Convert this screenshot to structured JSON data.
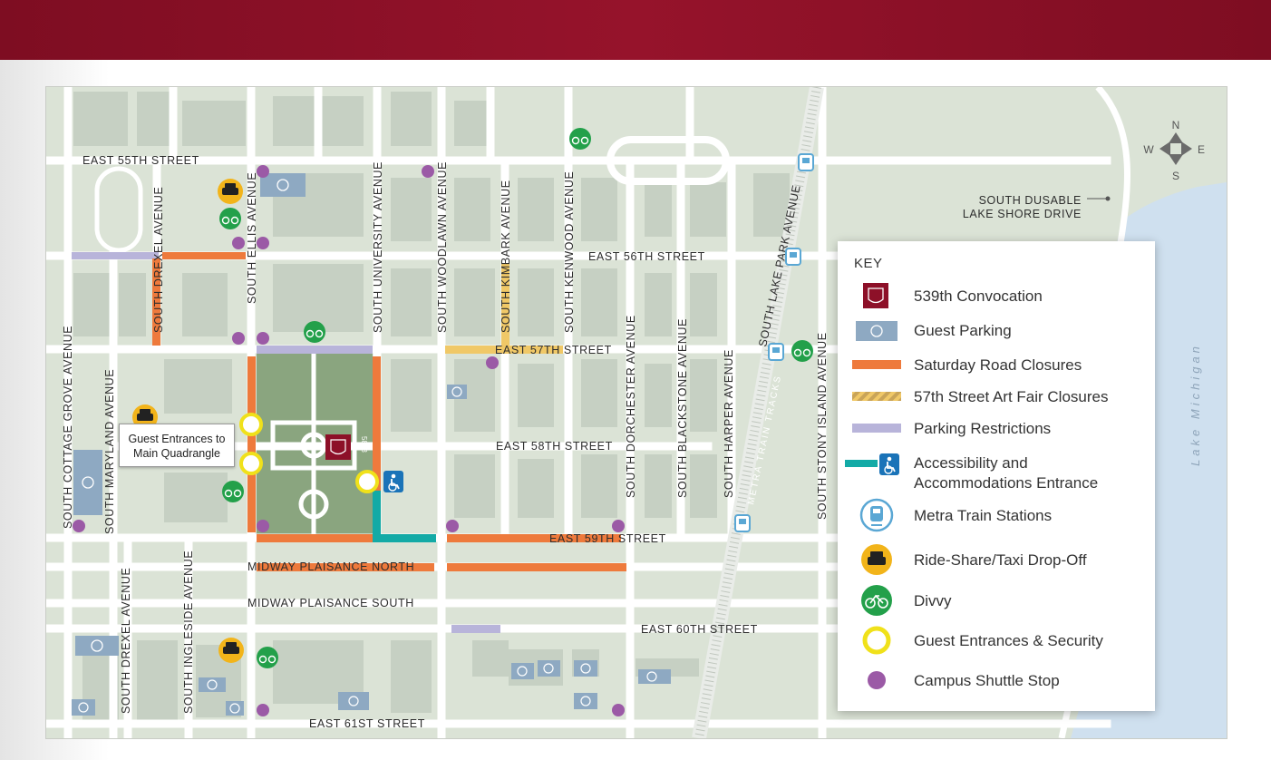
{
  "colors": {
    "header": "#8d1028",
    "road_closure": "#ee7a3c",
    "art_fair": "#f0c867",
    "parking_restriction": "#b8b4da",
    "accessibility": "#13aaa6",
    "shuttle": "#9b5aa6",
    "divvy": "#23a04a",
    "taxi": "#f2b41a",
    "parking": "#8ea9c2",
    "metra": "#5aa7d4",
    "convocation": "#8d1028"
  },
  "streets": {
    "e55": "EAST 55TH STREET",
    "e56": "EAST 56TH STREET",
    "e57": "EAST 57TH STREET",
    "e58": "EAST 58TH STREET",
    "e59": "EAST 59TH STREET",
    "e60": "EAST 60TH STREET",
    "e61": "EAST 61ST STREET",
    "mid_n": "MIDWAY PLAISANCE NORTH",
    "mid_s": "MIDWAY PLAISANCE SOUTH",
    "cottage": "SOUTH  COTTAGE GROVE AVENUE",
    "maryland": "SOUTH MARYLAND AVENUE",
    "drexel_n": "SOUTH DREXEL AVENUE",
    "drexel_s": "SOUTH DREXEL AVENUE",
    "ingleside": "SOUTH INGLESIDE AVENUE",
    "ellis": "SOUTH ELLIS AVENUE",
    "university": "SOUTH UNIVERSITY AVENUE",
    "woodlawn": "SOUTH WOODLAWN AVENUE",
    "kimbark": "SOUTH KIMBARK AVENUE",
    "kenwood": "SOUTH KENWOOD AVENUE",
    "dorchester": "SOUTH DORCHESTER AVENUE",
    "blackstone": "SOUTH BLACKSTONE AVENUE",
    "harper": "SOUTH HARPER AVENUE",
    "lake_park": "SOUTH LAKE PARK AVENUE",
    "stony_island": "SOUTH STONY ISLAND AVENUE",
    "metra_tracks": "METRA TRAIN TRACKS",
    "dusable_1": "SOUTH DUSABLE",
    "dusable_2": "LAKE SHORE DRIVE",
    "lake": "Lake Michigan",
    "building_5848": "5848"
  },
  "compass": {
    "n": "N",
    "s": "S",
    "e": "E",
    "w": "W"
  },
  "callout": {
    "line1": "Guest Entrances to",
    "line2": "Main Quadrangle"
  },
  "key": {
    "title": "KEY",
    "items": [
      {
        "label": "539th Convocation",
        "icon": "convocation-seal-icon"
      },
      {
        "label": "Guest Parking",
        "icon": "parking-icon"
      },
      {
        "label": "Saturday Road Closures",
        "icon": "road-closure-swatch"
      },
      {
        "label": "57th Street Art Fair Closures",
        "icon": "art-fair-swatch"
      },
      {
        "label": "Parking Restrictions",
        "icon": "parking-restriction-swatch"
      },
      {
        "label_1": "Accessibility and",
        "label_2": "Accommodations Entrance",
        "icon": "wheelchair-icon"
      },
      {
        "label": "Metra Train Stations",
        "icon": "train-icon"
      },
      {
        "label": "Ride-Share/Taxi Drop-Off",
        "icon": "taxi-icon"
      },
      {
        "label": "Divvy",
        "icon": "bicycle-icon"
      },
      {
        "label": "Guest Entrances & Security",
        "icon": "entrance-ring-icon"
      },
      {
        "label": "Campus Shuttle Stop",
        "icon": "shuttle-dot-icon"
      }
    ]
  }
}
